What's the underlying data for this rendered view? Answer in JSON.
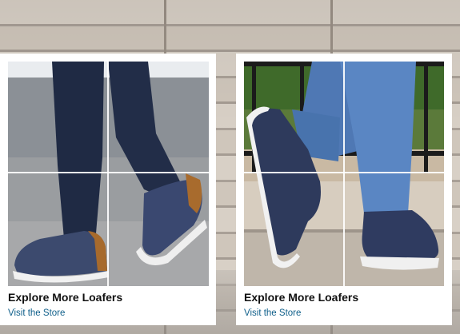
{
  "cards": [
    {
      "title": "Explore More Loafers",
      "link_label": "Visit the Store",
      "image": "man-walking-navy-pants-blue-loafers"
    },
    {
      "title": "Explore More Loafers",
      "link_label": "Visit the Store",
      "image": "man-stepping-jeans-blue-loafers"
    }
  ],
  "colors": {
    "title_text": "#111111",
    "link_text": "#0f5f8a",
    "card_background": "#ffffff"
  }
}
